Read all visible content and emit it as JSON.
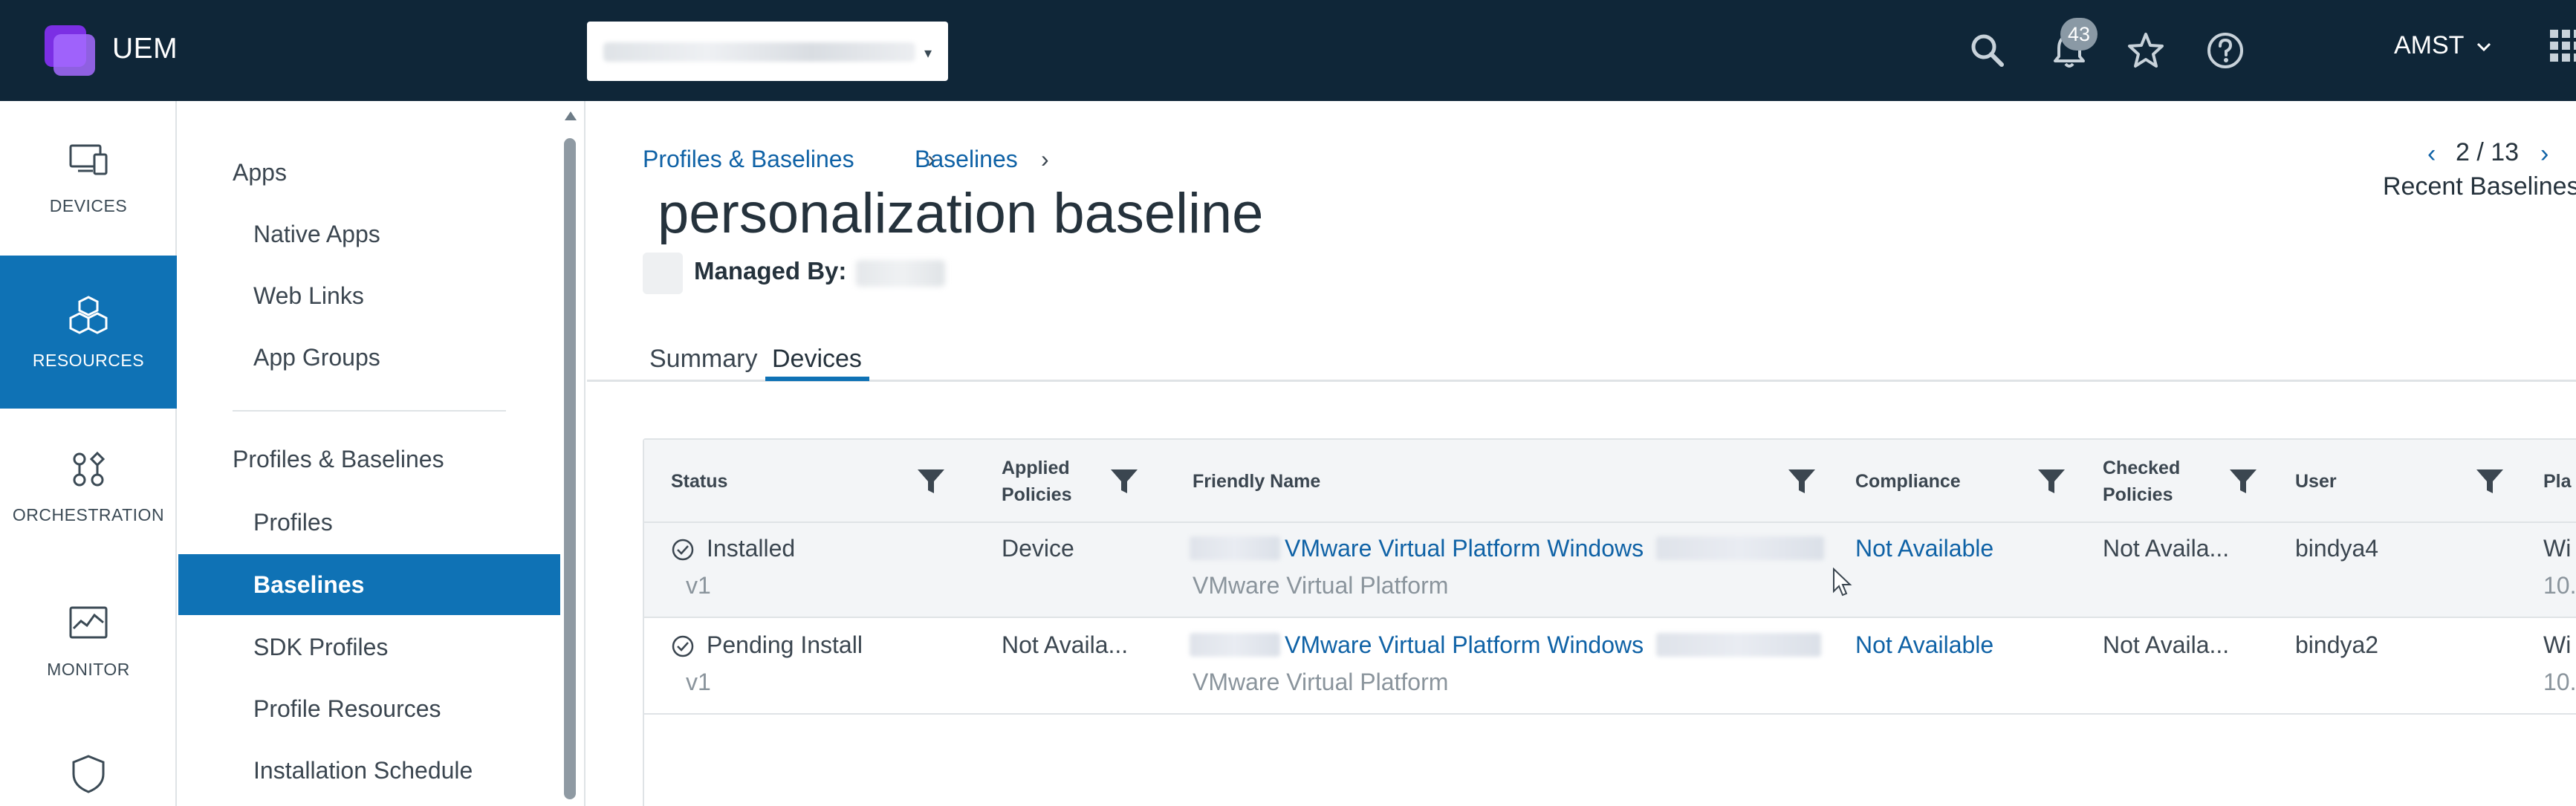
{
  "header": {
    "app_name": "UEM",
    "notification_count": "43",
    "org_name": "AMST",
    "icons": [
      "search-icon",
      "bell-icon",
      "star-icon",
      "help-icon",
      "app-grid-icon"
    ]
  },
  "rail": {
    "items": [
      {
        "label": "DEVICES",
        "icon": "devices-icon"
      },
      {
        "label": "RESOURCES",
        "icon": "resources-icon"
      },
      {
        "label": "ORCHESTRATION",
        "icon": "orchestration-icon"
      },
      {
        "label": "MONITOR",
        "icon": "monitor-icon"
      },
      {
        "label": "",
        "icon": "shield-icon"
      }
    ]
  },
  "subnav": {
    "apps_heading": "Apps",
    "apps_items": [
      "Native Apps",
      "Web Links",
      "App Groups"
    ],
    "profiles_heading": "Profiles & Baselines",
    "profiles_items": [
      "Profiles",
      "Baselines",
      "SDK Profiles",
      "Profile Resources",
      "Installation Schedule"
    ]
  },
  "main": {
    "breadcrumb": [
      "Profiles & Baselines",
      "Baselines"
    ],
    "title": "personalization baseline",
    "managed_by_label": "Managed By:",
    "pager": {
      "count": "2 / 13",
      "label": "Recent Baselines"
    },
    "tabs": [
      "Summary",
      "Devices"
    ],
    "active_tab": "Devices"
  },
  "table": {
    "columns": [
      {
        "label": "Status",
        "filter": true
      },
      {
        "label": "Applied\nPolicies",
        "filter": true
      },
      {
        "label": "Friendly Name",
        "filter": true
      },
      {
        "label": "Compliance",
        "filter": true
      },
      {
        "label": "Checked\nPolicies",
        "filter": true
      },
      {
        "label": "User",
        "filter": true
      },
      {
        "label": "Pla",
        "filter": false
      }
    ],
    "rows": [
      {
        "status": "Installed",
        "version": "v1",
        "applied_policies": "Device",
        "friendly_name": "VMware Virtual Platform Windows",
        "friendly_sub": "VMware Virtual Platform",
        "compliance": "Not Available",
        "checked_policies": "Not Availa...",
        "user": "bindya4",
        "platform": "Wi",
        "platform_sub": "10."
      },
      {
        "status": "Pending Install",
        "version": "v1",
        "applied_policies": "Not Availa...",
        "friendly_name": "VMware Virtual Platform Windows",
        "friendly_sub": "VMware Virtual Platform",
        "compliance": "Not Available",
        "checked_policies": "Not Availa...",
        "user": "bindya2",
        "platform": "Wi",
        "platform_sub": "10."
      }
    ]
  },
  "colors": {
    "header_bg": "#0f2638",
    "accent": "#0f72b5",
    "link": "#0f62a6"
  }
}
